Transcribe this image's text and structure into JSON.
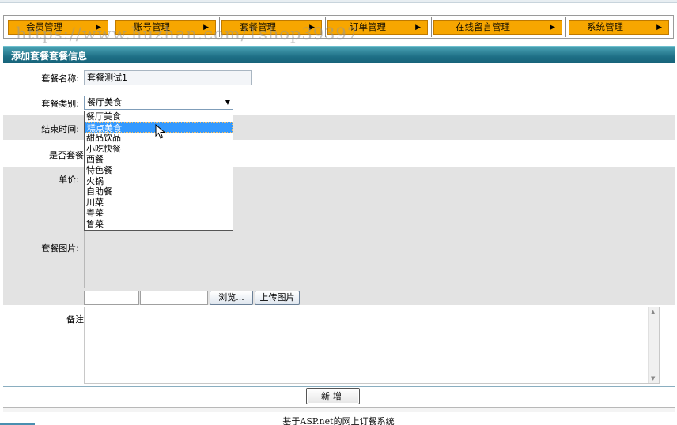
{
  "nav": {
    "items": [
      {
        "label": "会员管理"
      },
      {
        "label": "账号管理"
      },
      {
        "label": "套餐管理"
      },
      {
        "label": "订单管理"
      },
      {
        "label": "在线留言管理"
      },
      {
        "label": "系统管理"
      }
    ],
    "arrow": "▶"
  },
  "watermark": "https://www.huzhan.com/1shop39397",
  "section_title": "添加套餐套餐信息",
  "form": {
    "name_label": "套餐名称:",
    "name_value": "套餐测试1",
    "category_label": "套餐类别:",
    "category_selected": "餐厅美食",
    "category_options": [
      "餐厅美食",
      "糕点美食",
      "甜品饮品",
      "小吃快餐",
      "西餐",
      "特色餐",
      "火锅",
      "自助餐",
      "川菜",
      "粤菜",
      "鲁菜"
    ],
    "highlighted_option": "糕点美食",
    "end_time_label": "结束时间:",
    "is_package_label": "是否套餐",
    "price_label": "单价:",
    "image_label": "套餐图片:",
    "browse_label": "浏览...",
    "upload_label": "上传图片",
    "remark_label": "备注",
    "submit_label": "新增"
  },
  "footer": {
    "prefix": "基于",
    "tech": "ASP.net",
    "suffix": "的网上订餐系统"
  },
  "colors": {
    "nav_item_bg": "#f7a600",
    "section_bar": "#1e6f86",
    "gray_row": "#e3e3e3",
    "highlight": "#3399ff"
  }
}
